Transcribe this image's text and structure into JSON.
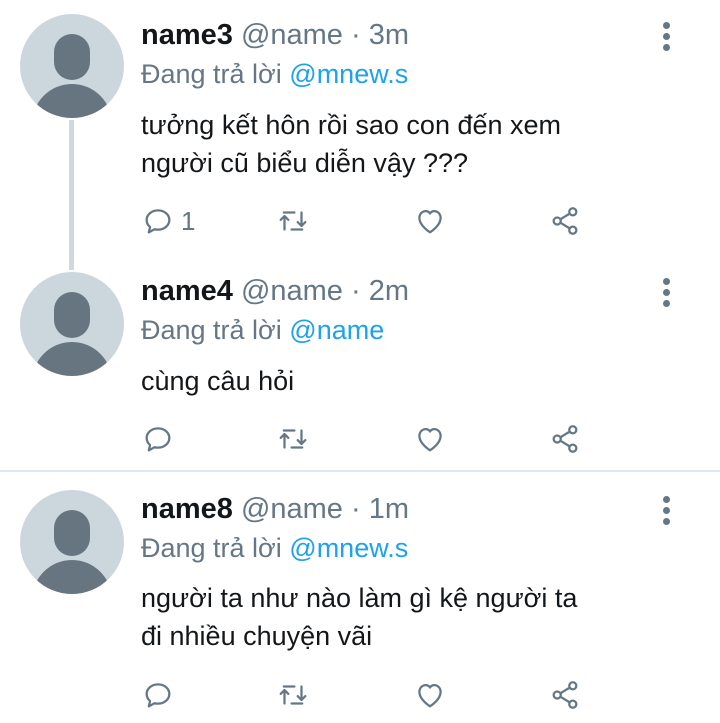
{
  "tweets": [
    {
      "name": "name3",
      "handle": "@name",
      "separator": "·",
      "time": "3m",
      "replying_label": "Đang trả lời",
      "replying_to": "@mnew.s",
      "text_lines": [
        "tưởng kết hôn rồi sao con đến xem",
        "người cũ biểu diễn vậy ???"
      ],
      "reply_count": "1"
    },
    {
      "name": "name4",
      "handle": "@name",
      "separator": "·",
      "time": "2m",
      "replying_label": "Đang trả lời",
      "replying_to": "@name",
      "text_lines": [
        "cùng câu hỏi"
      ],
      "reply_count": ""
    },
    {
      "name": "name8",
      "handle": "@name",
      "separator": "·",
      "time": "1m",
      "replying_label": "Đang trả lời",
      "replying_to": "@mnew.s",
      "text_lines": [
        "người ta như nào làm gì kệ người ta",
        "đi nhiều chuyện vãi"
      ],
      "reply_count": ""
    }
  ],
  "icons": {
    "reply": "reply-icon",
    "retweet": "retweet-icon",
    "like": "like-icon",
    "share": "share-icon",
    "more": "more-vertical-icon"
  },
  "colors": {
    "name": "#14171a",
    "meta": "#657786",
    "mention": "#1da1f2",
    "avatar_bg": "#ccd6dd",
    "avatar_fg": "#66757f"
  }
}
